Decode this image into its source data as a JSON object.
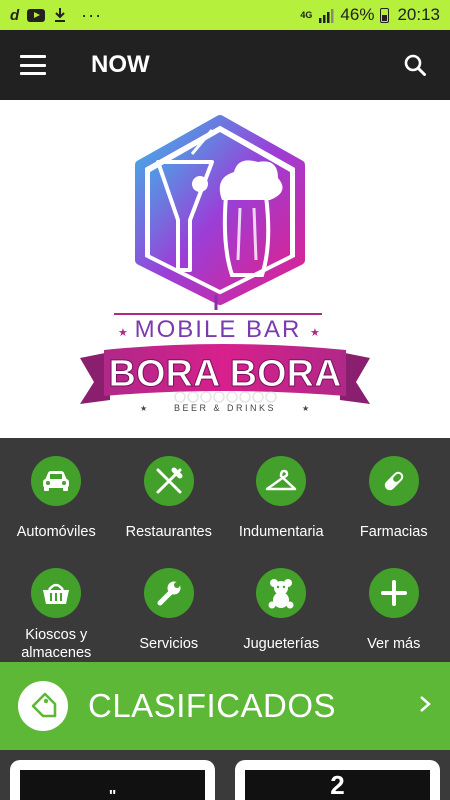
{
  "status_bar": {
    "battery_percent": "46%",
    "time": "20:13",
    "network": "4G",
    "icons": [
      "d-app-icon",
      "youtube-icon",
      "download-icon",
      "more-icon",
      "signal-icon",
      "battery-icon"
    ]
  },
  "app_bar": {
    "title": "NOW"
  },
  "banner": {
    "line1": "MOBILE BAR",
    "line2": "BORA BORA",
    "line3": "BEER & DRINKS",
    "gradient_colors": [
      "#3ab8e8",
      "#9a3fd8",
      "#e0208c"
    ]
  },
  "categories": [
    {
      "label": "Automóviles",
      "icon": "car-icon"
    },
    {
      "label": "Restaurantes",
      "icon": "fork-knife-icon"
    },
    {
      "label": "Indumentaria",
      "icon": "hanger-icon"
    },
    {
      "label": "Farmacias",
      "icon": "pill-icon"
    },
    {
      "label": "Kioscos y\nalmacenes",
      "icon": "basket-icon"
    },
    {
      "label": "Servicios",
      "icon": "wrench-icon"
    },
    {
      "label": "Jugueterías",
      "icon": "teddy-bear-icon"
    },
    {
      "label": "Ver más",
      "icon": "plus-icon"
    }
  ],
  "clasificados": {
    "label": "CLASIFICADOS"
  },
  "cards": [
    {
      "text": "\""
    },
    {
      "text": "2"
    }
  ],
  "colors": {
    "status_bar": "#b4f03c",
    "app_bar": "#212121",
    "grid_bg": "#3a3a3a",
    "category_green": "#43a02a",
    "clasificados_green": "#5cb836"
  }
}
